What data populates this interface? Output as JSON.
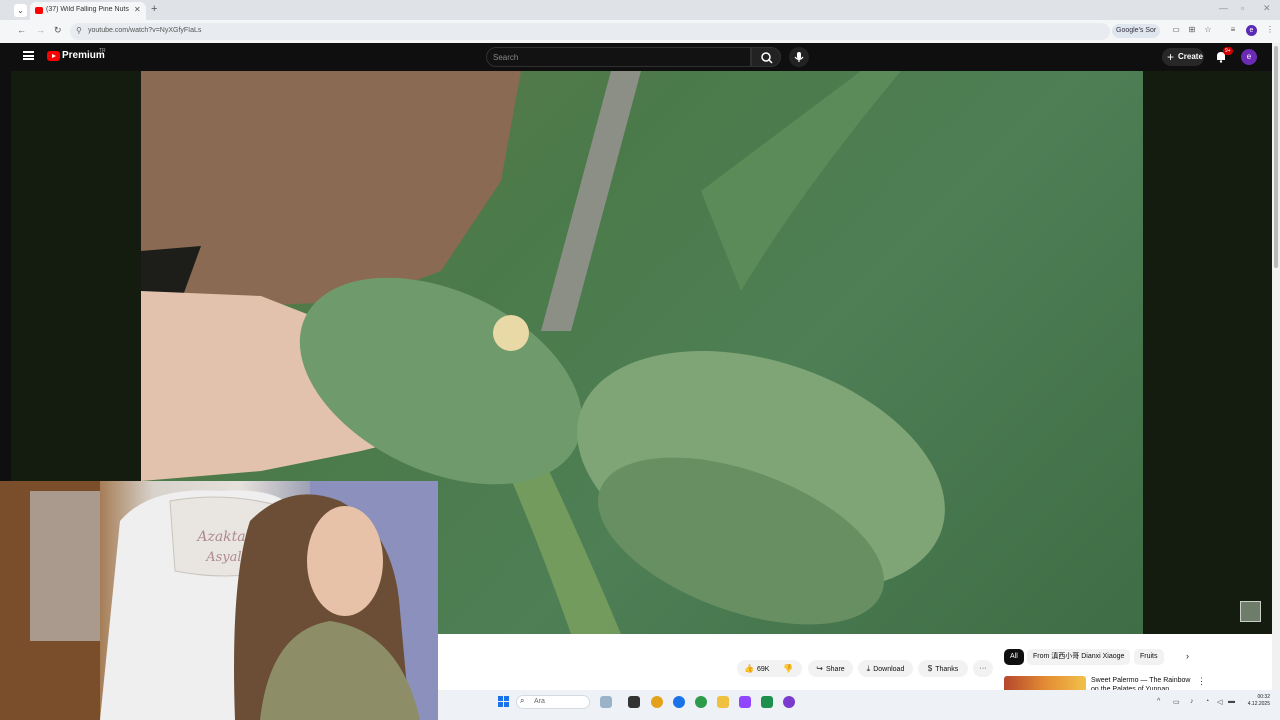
{
  "browser": {
    "tab_title": "(37) Wild Falling Pine Nuts from",
    "url": "youtube.com/watch?v=NyXGfyFIaLs",
    "google_search_chip": "Google's Sor",
    "profile_initial": "e"
  },
  "youtube": {
    "brand": "Premium",
    "country_code": "TR",
    "search_placeholder": "Search",
    "create_label": "Create",
    "notification_count": "9+",
    "avatar_initial": "e"
  },
  "actions": {
    "like_count": "69K",
    "share_label": "Share",
    "download_label": "Download",
    "thanks_label": "Thanks"
  },
  "chips": [
    {
      "label": "All",
      "active": true
    },
    {
      "label": "From 滇西小哥 Dianxi Xiaoge",
      "active": false
    },
    {
      "label": "Fruits",
      "active": false
    }
  ],
  "recommendation": {
    "title": "Sweet Palermo — The Rainbow on the Palates of Yunnan"
  },
  "taskbar": {
    "search_placeholder": "Ara",
    "time": "00:32",
    "date": "4.12.2025"
  },
  "colors": {
    "youtube_red": "#ff0000",
    "header_bg": "#0f0f0f",
    "accent_blue": "#1a73e8"
  }
}
